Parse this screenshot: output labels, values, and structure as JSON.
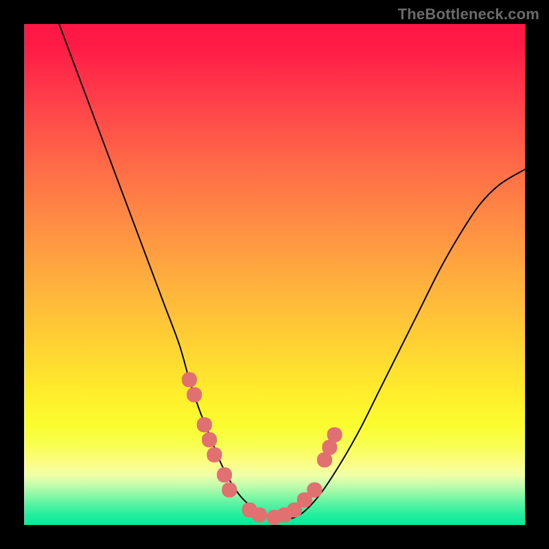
{
  "watermark": "TheBottleneck.com",
  "colors": {
    "background": "#000000",
    "gradient_top": "#ff1846",
    "gradient_mid": "#ffee2b",
    "gradient_bottom": "#03eb9b",
    "curve": "#000000",
    "marker": "#e17070",
    "watermark_text": "#6a6a6a"
  },
  "chart_data": {
    "type": "line",
    "title": "",
    "xlabel": "",
    "ylabel": "",
    "xlim": [
      0,
      100
    ],
    "ylim": [
      0,
      100
    ],
    "grid": false,
    "legend": false,
    "series": [
      {
        "name": "curve",
        "x": [
          7,
          10,
          13,
          16,
          19,
          22,
          25,
          28,
          31,
          33,
          35,
          37,
          39,
          41,
          43,
          45,
          48,
          51,
          55,
          59,
          63,
          67,
          71,
          75,
          79,
          83,
          87,
          91,
          95,
          100
        ],
        "y": [
          100,
          92,
          84,
          76,
          68,
          60,
          52,
          44,
          36,
          29,
          23,
          18,
          13,
          9,
          6,
          4,
          2,
          1,
          2,
          6,
          12,
          19,
          27,
          35,
          43,
          51,
          58,
          64,
          68,
          71
        ]
      }
    ],
    "markers": [
      {
        "x": 33,
        "y": 29
      },
      {
        "x": 34,
        "y": 26
      },
      {
        "x": 36,
        "y": 20
      },
      {
        "x": 37,
        "y": 17
      },
      {
        "x": 38,
        "y": 14
      },
      {
        "x": 40,
        "y": 10
      },
      {
        "x": 41,
        "y": 7
      },
      {
        "x": 45,
        "y": 3
      },
      {
        "x": 47,
        "y": 2
      },
      {
        "x": 50,
        "y": 1.5
      },
      {
        "x": 52,
        "y": 2
      },
      {
        "x": 54,
        "y": 3
      },
      {
        "x": 56,
        "y": 5
      },
      {
        "x": 58,
        "y": 7
      },
      {
        "x": 60,
        "y": 13
      },
      {
        "x": 61,
        "y": 15.5
      },
      {
        "x": 62,
        "y": 18
      }
    ],
    "annotations": [
      {
        "text": "TheBottleneck.com",
        "role": "watermark"
      }
    ]
  }
}
